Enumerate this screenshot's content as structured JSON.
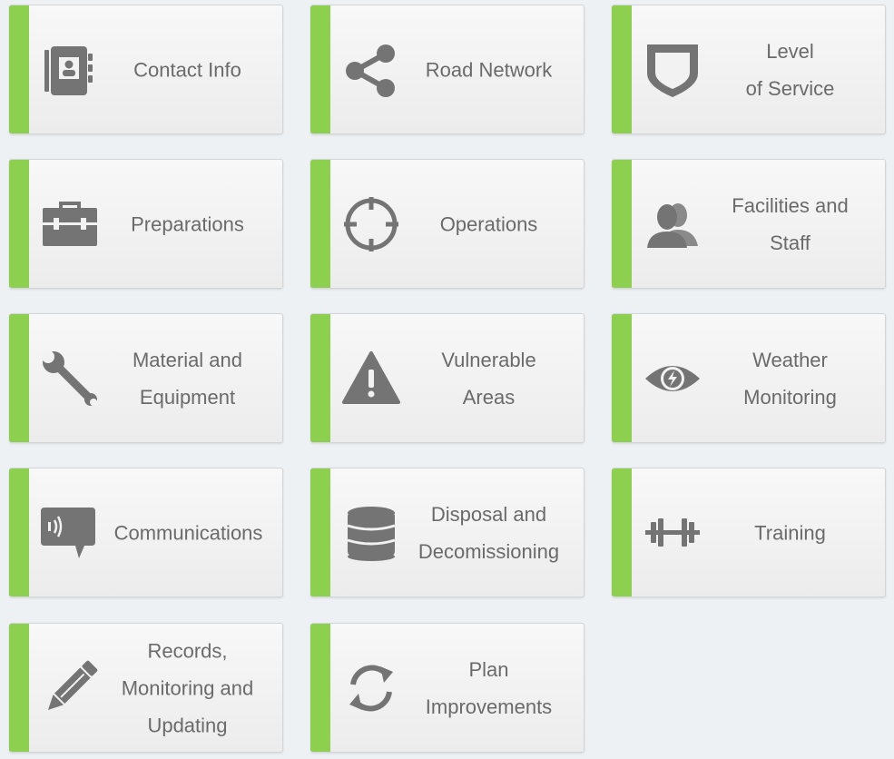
{
  "colors": {
    "accent": "#8dcf4f",
    "icon": "#747474",
    "text": "#6a6a6a",
    "background": "#edf1f4"
  },
  "tiles": [
    {
      "label": "Contact Info",
      "icon": "address-book-icon"
    },
    {
      "label": "Road Network",
      "icon": "share-icon"
    },
    {
      "label": "Level\nof Service",
      "icon": "shield-icon"
    },
    {
      "label": "Preparations",
      "icon": "toolbox-icon"
    },
    {
      "label": "Operations",
      "icon": "crosshair-icon"
    },
    {
      "label": "Facilities and\nStaff",
      "icon": "users-icon"
    },
    {
      "label": "Material and\nEquipment",
      "icon": "wrench-icon"
    },
    {
      "label": "Vulnerable\nAreas",
      "icon": "warning-icon"
    },
    {
      "label": "Weather\nMonitoring",
      "icon": "eye-bolt-icon"
    },
    {
      "label": "Communications",
      "icon": "speech-bubble-icon"
    },
    {
      "label": "Disposal and\nDecomissioning",
      "icon": "database-icon"
    },
    {
      "label": "Training",
      "icon": "dumbbell-icon"
    },
    {
      "label": "Records,\nMonitoring and\nUpdating",
      "icon": "pencil-icon"
    },
    {
      "label": "Plan\nImprovements",
      "icon": "refresh-icon"
    }
  ]
}
